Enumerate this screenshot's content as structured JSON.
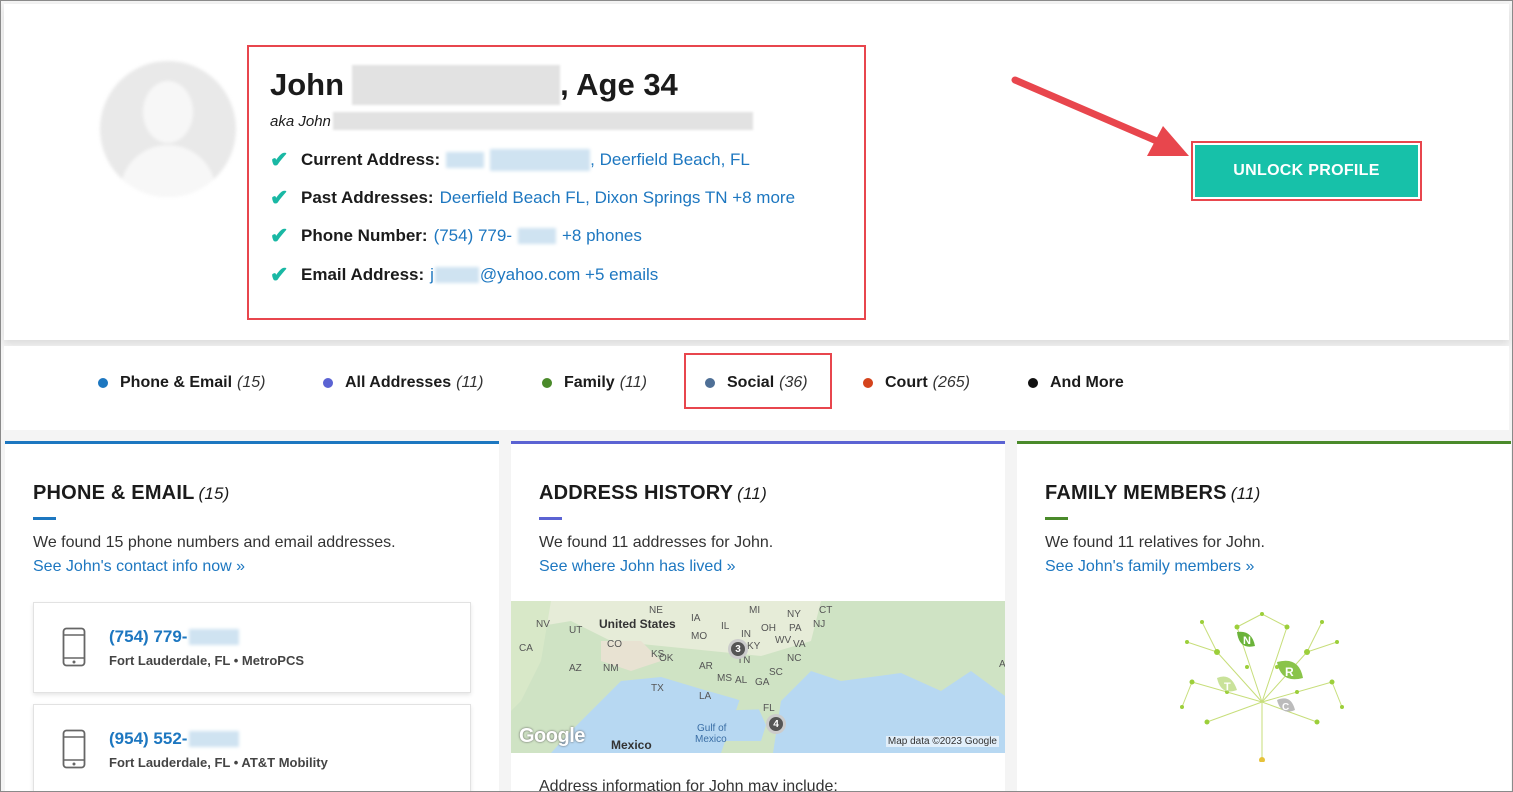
{
  "profile": {
    "first_name": "John",
    "age_text": ", Age 34",
    "aka_prefix": "aka John",
    "current_address_label": "Current Address:",
    "current_address_value": ", Deerfield Beach, FL",
    "past_addresses_label": "Past Addresses:",
    "past_addresses_value": "Deerfield Beach FL, Dixon Springs TN +8 more",
    "phone_label": "Phone Number:",
    "phone_value_prefix": "(754) 779-",
    "phone_value_suffix": "+8 phones",
    "email_label": "Email Address:",
    "email_value_prefix": "j",
    "email_value_suffix": "@yahoo.com +5 emails"
  },
  "unlock_button": {
    "label": "UNLOCK PROFILE"
  },
  "tabs": [
    {
      "label": "Phone & Email",
      "count": "(15)",
      "color": "#1d77c0"
    },
    {
      "label": "All Addresses",
      "count": "(11)",
      "color": "#5b63d3"
    },
    {
      "label": "Family",
      "count": "(11)",
      "color": "#4a8a2a"
    },
    {
      "label": "Social",
      "count": "(36)",
      "color": "#4e6f96"
    },
    {
      "label": "Court",
      "count": "(265)",
      "color": "#d4431c"
    },
    {
      "label": "And More",
      "count": "",
      "color": "#111111"
    }
  ],
  "cards": {
    "phone_email": {
      "title": "PHONE & EMAIL",
      "count": "(15)",
      "color": "#1d77c0",
      "text": "We found 15 phone numbers and email addresses.",
      "link": "See John's contact info now »",
      "items": [
        {
          "number": "(754) 779-",
          "meta": "Fort Lauderdale, FL • MetroPCS"
        },
        {
          "number": "(954) 552-",
          "meta": "Fort Lauderdale, FL • AT&T Mobility"
        }
      ]
    },
    "address_history": {
      "title": "ADDRESS HISTORY",
      "count": "(11)",
      "color": "#5b63d3",
      "text": "We found 11 addresses for John.",
      "link": "See where John has lived »",
      "more_text": "Address information for John may include:",
      "map": {
        "country_label": "United States",
        "mexico_label": "Mexico",
        "gulf_label_1": "Gulf of",
        "gulf_label_2": "Mexico",
        "credit": "Map data ©2023 Google",
        "google": "Google",
        "cluster_1": "3",
        "cluster_2": "4",
        "states": [
          "NV",
          "UT",
          "NE",
          "IA",
          "MI",
          "NY",
          "CT",
          "CO",
          "KS",
          "MO",
          "IL",
          "IN",
          "OH",
          "PA",
          "NJ",
          "CA",
          "AZ",
          "NM",
          "OK",
          "TN",
          "KY",
          "WV",
          "VA",
          "NC",
          "SC",
          "TX",
          "AR",
          "MS",
          "AL",
          "GA",
          "LA",
          "FL",
          "A"
        ]
      }
    },
    "family": {
      "title": "FAMILY MEMBERS",
      "count": "(11)",
      "color": "#4a8a2a",
      "text": "We found 11 relatives for John.",
      "link": "See John's family members »",
      "tree_letters": [
        "N",
        "R",
        "T",
        "C"
      ]
    }
  }
}
